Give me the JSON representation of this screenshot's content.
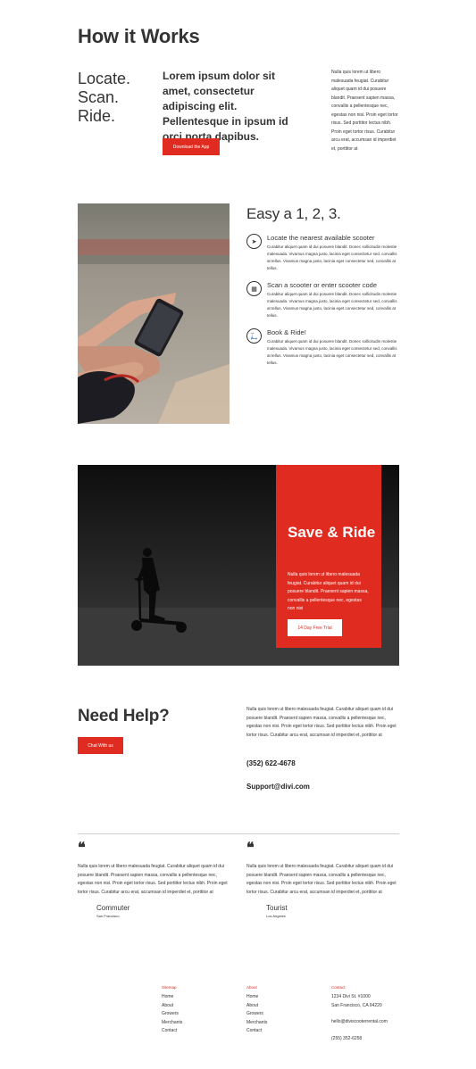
{
  "how": {
    "title": "How it Works",
    "steps": [
      "Locate.",
      "Scan.",
      "Ride."
    ],
    "lead": "Lorem ipsum dolor sit amet, consectetur adipiscing elit. Pellentesque in ipsum id orci porta dapibus.",
    "button": "Download the App",
    "body": "Nulla quis lorem ut libero malesuada feugiat. Curabitur aliquet quam id dui posuere blandit. Praesent sapien massa, convallis a pellentesque nec, egestas non nisi. Proin eget tortor risus. Sed porttitor lectus nibh. Proin eget tortor risus. Curabitur arcu erat, accumsan id imperdiet et, porttitor at"
  },
  "easy": {
    "title": "Easy a 1, 2, 3.",
    "items": [
      {
        "icon": "navigation-arrow-icon",
        "title": "Locate the nearest available scooter",
        "text": "Curabitur aliquet quam id dui posuere blandit. Donec sollicitudin molestie malesuada. Vivamus magna justo, lacinia eget consectetur sed, convallis at tellus. Vivamus magna justo, lacinia eget consectetur sed, convallis at tellus."
      },
      {
        "icon": "qr-code-icon",
        "title": "Scan a scooter or enter scooter code",
        "text": "Curabitur aliquet quam id dui posuere blandit. Donec sollicitudin molestie malesuada. Vivamus magna justo, lacinia eget consectetur sed, convallis at tellus. Vivamus magna justo, lacinia eget consectetur sed, convallis at tellus."
      },
      {
        "icon": "scooter-icon",
        "title": "Book & Ride!",
        "text": "Curabitur aliquet quam id dui posuere blandit. Donec sollicitudin molestie malesuada. Vivamus magna justo, lacinia eget consectetur sed, convallis at tellus. Vivamus magna justo, lacinia eget consectetur sed, convallis at tellus."
      }
    ]
  },
  "save": {
    "title": "Save & Ride",
    "text": "Nulla quis lorem ut libero malesuada feugiat. Curabitur aliquet quam id dui posuere blandit. Praesent sapien massa, convallis a pellentesque nec, egestas non nisi",
    "button": "14 Day Free Trial"
  },
  "help": {
    "title": "Need Help?",
    "button": "Chat With us",
    "text": "Nulla quis lorem ut libero malesuada feugiat. Curabitur aliquet quam id dui posuere blandit. Praesent sapien massa, convallis a pellentesque nec, egestas non nisi. Proin eget tortor risus. Sed porttitor lectus nibh. Proin eget tortor risus. Curabitur arcu erat, accumsan id imperdiet et, porttitor at",
    "phone": "(352) 622-4678",
    "email": "Support@divi.com"
  },
  "testimonials": [
    {
      "quote": "Nulla quis lorem ut libero malesuada feugiat. Curabitur aliquet quam id dui posuere blandit. Praesent sapien massa, convallis a pellentesque nec, egestas non nisi. Proin eget tortor risus. Sed porttitor lectus nibh. Proin eget tortor risus. Curabitur arcu erat, accumsan id imperdiet et, porttitor at",
      "name": "Commuter",
      "location": "San Francisco"
    },
    {
      "quote": "Nulla quis lorem ut libero malesuada feugiat. Curabitur aliquet quam id dui posuere blandit. Praesent sapien massa, convallis a pellentesque nec, egestas non nisi. Proin eget tortor risus. Sed porttitor lectus nibh. Proin eget tortor risus. Curabitur arcu erat, accumsan id imperdiet et, porttitor at",
      "name": "Tourist",
      "location": "Los Angeles"
    }
  ],
  "footer": {
    "sitemap": {
      "heading": "Sitemap",
      "links": [
        "Home",
        "About",
        "Growers",
        "Merchants",
        "Contact"
      ]
    },
    "about": {
      "heading": "About",
      "links": [
        "Home",
        "About",
        "Growers",
        "Merchants",
        "Contact"
      ]
    },
    "contact": {
      "heading": "Contact",
      "address1": "1234 Divi St. #1000",
      "address2": "San Francisco, CA 94220",
      "email": "hello@diviscooterrental.com",
      "phone": "(255) 352-6258"
    }
  },
  "colors": {
    "accent": "#e02b20",
    "text": "#333333",
    "dark": "#1a1a1a"
  }
}
